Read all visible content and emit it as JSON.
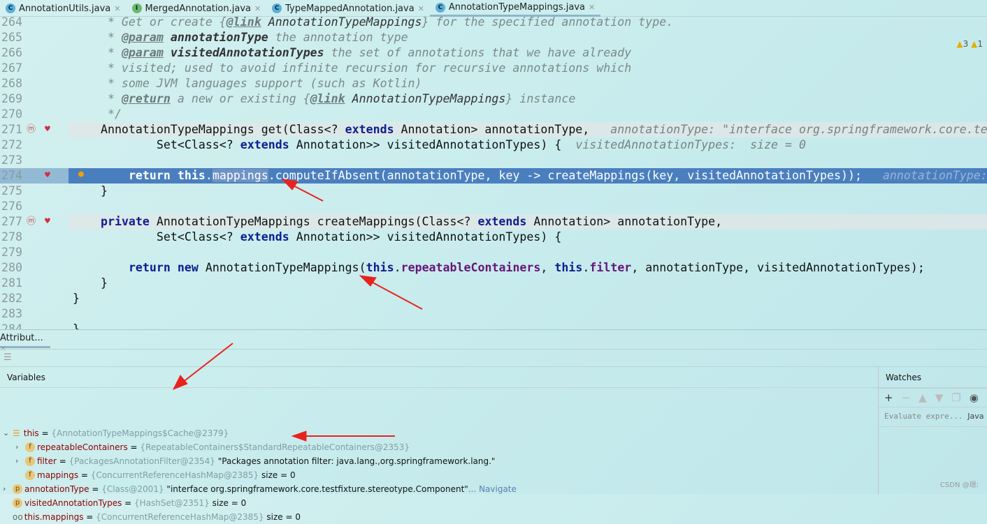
{
  "tabs": [
    {
      "label": "AnnotationUtils.java",
      "icon": "C",
      "active": false
    },
    {
      "label": "MergedAnnotation.java",
      "icon": "I",
      "active": false
    },
    {
      "label": "TypeMappedAnnotation.java",
      "icon": "C",
      "active": false
    },
    {
      "label": "AnnotationTypeMappings.java",
      "icon": "C",
      "active": true
    }
  ],
  "inspections": {
    "warnings": "3",
    "weak_warnings": "1"
  },
  "editor": {
    "lines": [
      {
        "n": "264",
        "tokens": [
          [
            "cm",
            "     * Get or create {"
          ],
          [
            "tag",
            "@link"
          ],
          [
            "cmr",
            " AnnotationTypeMappings"
          ],
          [
            "cm",
            "} for the specified annotation type."
          ]
        ]
      },
      {
        "n": "265",
        "tokens": [
          [
            "cm",
            "     * "
          ],
          [
            "tag",
            "@param"
          ],
          [
            "cmb",
            " annotationType"
          ],
          [
            "cm",
            " the annotation type"
          ]
        ]
      },
      {
        "n": "266",
        "tokens": [
          [
            "cm",
            "     * "
          ],
          [
            "tag",
            "@param"
          ],
          [
            "cmb",
            " visitedAnnotationTypes"
          ],
          [
            "cm",
            " the set of annotations that we have already"
          ]
        ]
      },
      {
        "n": "267",
        "tokens": [
          [
            "cm",
            "     * visited; used to avoid infinite recursion for recursive annotations which"
          ]
        ]
      },
      {
        "n": "268",
        "tokens": [
          [
            "cm",
            "     * some JVM languages support (such as Kotlin)"
          ]
        ]
      },
      {
        "n": "269",
        "tokens": [
          [
            "cm",
            "     * "
          ],
          [
            "tag",
            "@return"
          ],
          [
            "cm",
            " a new or existing {"
          ],
          [
            "tag",
            "@link"
          ],
          [
            "cmr",
            " AnnotationTypeMappings"
          ],
          [
            "cm",
            "} instance"
          ]
        ]
      },
      {
        "n": "270",
        "tokens": [
          [
            "cm",
            "     */"
          ]
        ]
      },
      {
        "n": "271",
        "style": "grey",
        "tokens": [
          [
            "",
            "    AnnotationTypeMappings get(Class<? "
          ],
          [
            "kw",
            "extends"
          ],
          [
            "",
            " Annotation> annotationType,  "
          ],
          [
            "hint",
            " annotationType: \"interface org.springframework.core.testfixture.stereotype.Component\""
          ]
        ]
      },
      {
        "n": "272",
        "tokens": [
          [
            "",
            "            Set<Class<? "
          ],
          [
            "kw",
            "extends"
          ],
          [
            "",
            " Annotation>> visitedAnnotationTypes) {  "
          ],
          [
            "hint",
            "visitedAnnotationTypes:  size = 0"
          ]
        ]
      },
      {
        "n": "273",
        "tokens": []
      },
      {
        "n": "274",
        "style": "hl",
        "tokens": [
          [
            "",
            "        "
          ],
          [
            "kw",
            "return this"
          ],
          [
            ".",
            ""
          ],
          [
            "selw",
            "mappings"
          ],
          [
            "",
            ".computeIfAbsent(annotationType, key -> createMappings(key, visitedAnnotationTypes));  "
          ],
          [
            "hint",
            " annotationType: \"interface org.springframework\""
          ]
        ]
      },
      {
        "n": "275",
        "tokens": [
          [
            "",
            "    }"
          ]
        ]
      },
      {
        "n": "276",
        "tokens": []
      },
      {
        "n": "277",
        "style": "grey",
        "tokens": [
          [
            "",
            "    "
          ],
          [
            "kw",
            "private"
          ],
          [
            "",
            " AnnotationTypeMappings createMappings(Class<? "
          ],
          [
            "kw",
            "extends"
          ],
          [
            "",
            " Annotation> annotationType,"
          ]
        ]
      },
      {
        "n": "278",
        "tokens": [
          [
            "",
            "            Set<Class<? "
          ],
          [
            "kw",
            "extends"
          ],
          [
            "",
            " Annotation>> visitedAnnotationTypes) {"
          ]
        ]
      },
      {
        "n": "279",
        "tokens": []
      },
      {
        "n": "280",
        "tokens": [
          [
            "",
            "        "
          ],
          [
            "kw",
            "return new"
          ],
          [
            "",
            " AnnotationTypeMappings("
          ],
          [
            "kw",
            "this"
          ],
          [
            "",
            "."
          ],
          [
            "fld",
            "repeatableContainers"
          ],
          [
            "",
            ", "
          ],
          [
            "kw",
            "this"
          ],
          [
            "",
            "."
          ],
          [
            "fld",
            "filter"
          ],
          [
            "",
            ", annotationType, visitedAnnotationTypes);"
          ]
        ]
      },
      {
        "n": "281",
        "tokens": [
          [
            "",
            "    }"
          ]
        ]
      },
      {
        "n": "282",
        "tokens": [
          [
            "",
            "}"
          ]
        ]
      },
      {
        "n": "283",
        "tokens": []
      },
      {
        "n": "284",
        "tokens": [
          [
            "",
            "}"
          ]
        ]
      }
    ]
  },
  "debug": {
    "tab_label": "Attribut...",
    "variables_title": "Variables",
    "variables": [
      {
        "indent": 0,
        "expand": "open",
        "badge": "this",
        "name": "this",
        "type": "{AnnotationTypeMappings$Cache@2379}",
        "value": ""
      },
      {
        "indent": 1,
        "expand": "closed",
        "badge": "f",
        "name": "repeatableContainers",
        "type": "{RepeatableContainers$StandardRepeatableContainers@2353}",
        "value": ""
      },
      {
        "indent": 1,
        "expand": "closed",
        "badge": "f",
        "name": "filter",
        "type": "{PackagesAnnotationFilter@2354}",
        "value": "\"Packages annotation filter: java.lang.,org.springframework.lang.\""
      },
      {
        "indent": 1,
        "expand": "none",
        "badge": "f",
        "name": "mappings",
        "type": "{ConcurrentReferenceHashMap@2385}",
        "value": " size = 0"
      },
      {
        "indent": 0,
        "expand": "closed",
        "badge": "p",
        "name": "annotationType",
        "type": "{Class@2001}",
        "value": "\"interface org.springframework.core.testfixture.stereotype.Component\"",
        "link": "... Navigate"
      },
      {
        "indent": 0,
        "expand": "none",
        "badge": "p",
        "name": "visitedAnnotationTypes",
        "type": "{HashSet@2351}",
        "value": " size = 0"
      },
      {
        "indent": 0,
        "expand": "none",
        "badge": "oo",
        "name": "this.mappings",
        "type": "{ConcurrentReferenceHashMap@2385}",
        "value": " size = 0"
      }
    ],
    "watches_title": "Watches",
    "watch_placeholder": "Evaluate expre...",
    "watch_lang": "Java"
  },
  "watermark": "CSDN @璟:",
  "colors": {
    "highlight": "#4a7fbf",
    "keyword": "#0b1f8f",
    "field": "#66157a",
    "annotation_arrow": "#e8231e"
  }
}
